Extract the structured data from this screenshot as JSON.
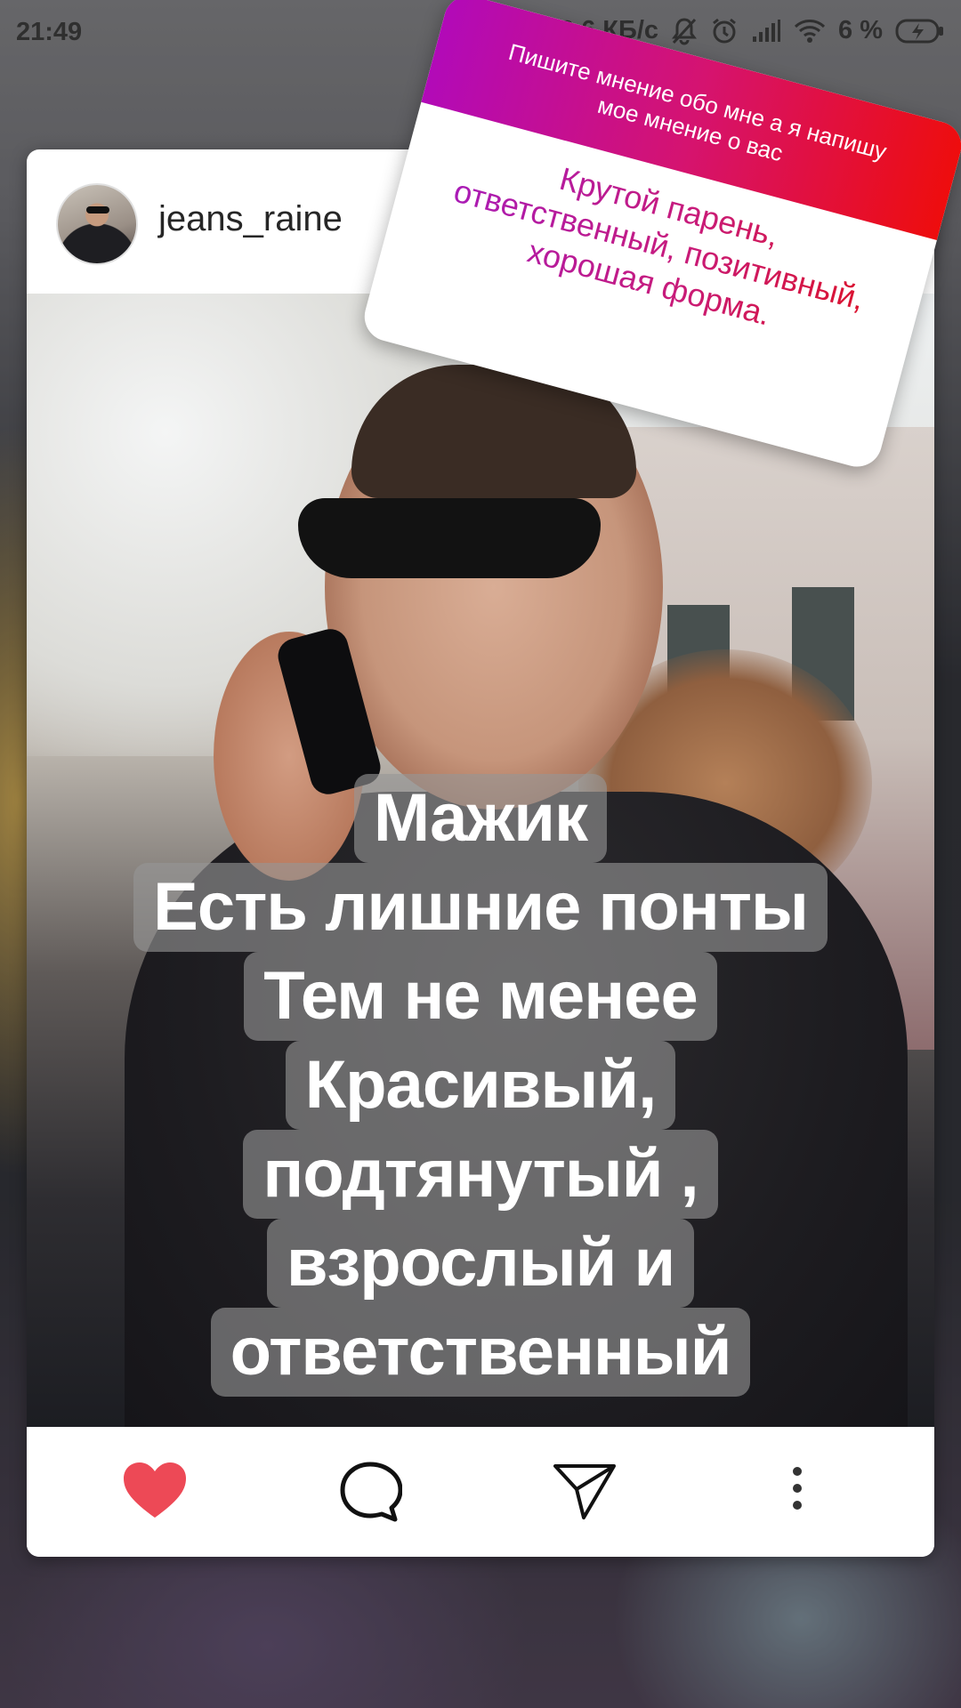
{
  "status_bar": {
    "time": "21:49",
    "speed": "12,6 КБ/с",
    "battery": "6 %"
  },
  "post": {
    "username": "jeans_raine",
    "overlay_lines": [
      "Мажик",
      "Есть лишние понты",
      "Тем не менее",
      "Красивый,",
      "подтянутый ,",
      "взрослый и",
      "ответственный"
    ]
  },
  "sticker": {
    "question": "Пишите мнение обо мне а я напишу мое мнение о вас",
    "answer": "Крутой парень, ответственный, позитивный, хорошая форма."
  },
  "colors": {
    "like": "#ed4956",
    "sticker_gradient_start": "#b20ab8",
    "sticker_gradient_end": "#ee0d0d"
  },
  "icons": [
    "heart-icon",
    "comment-icon",
    "send-icon",
    "more-icon"
  ]
}
